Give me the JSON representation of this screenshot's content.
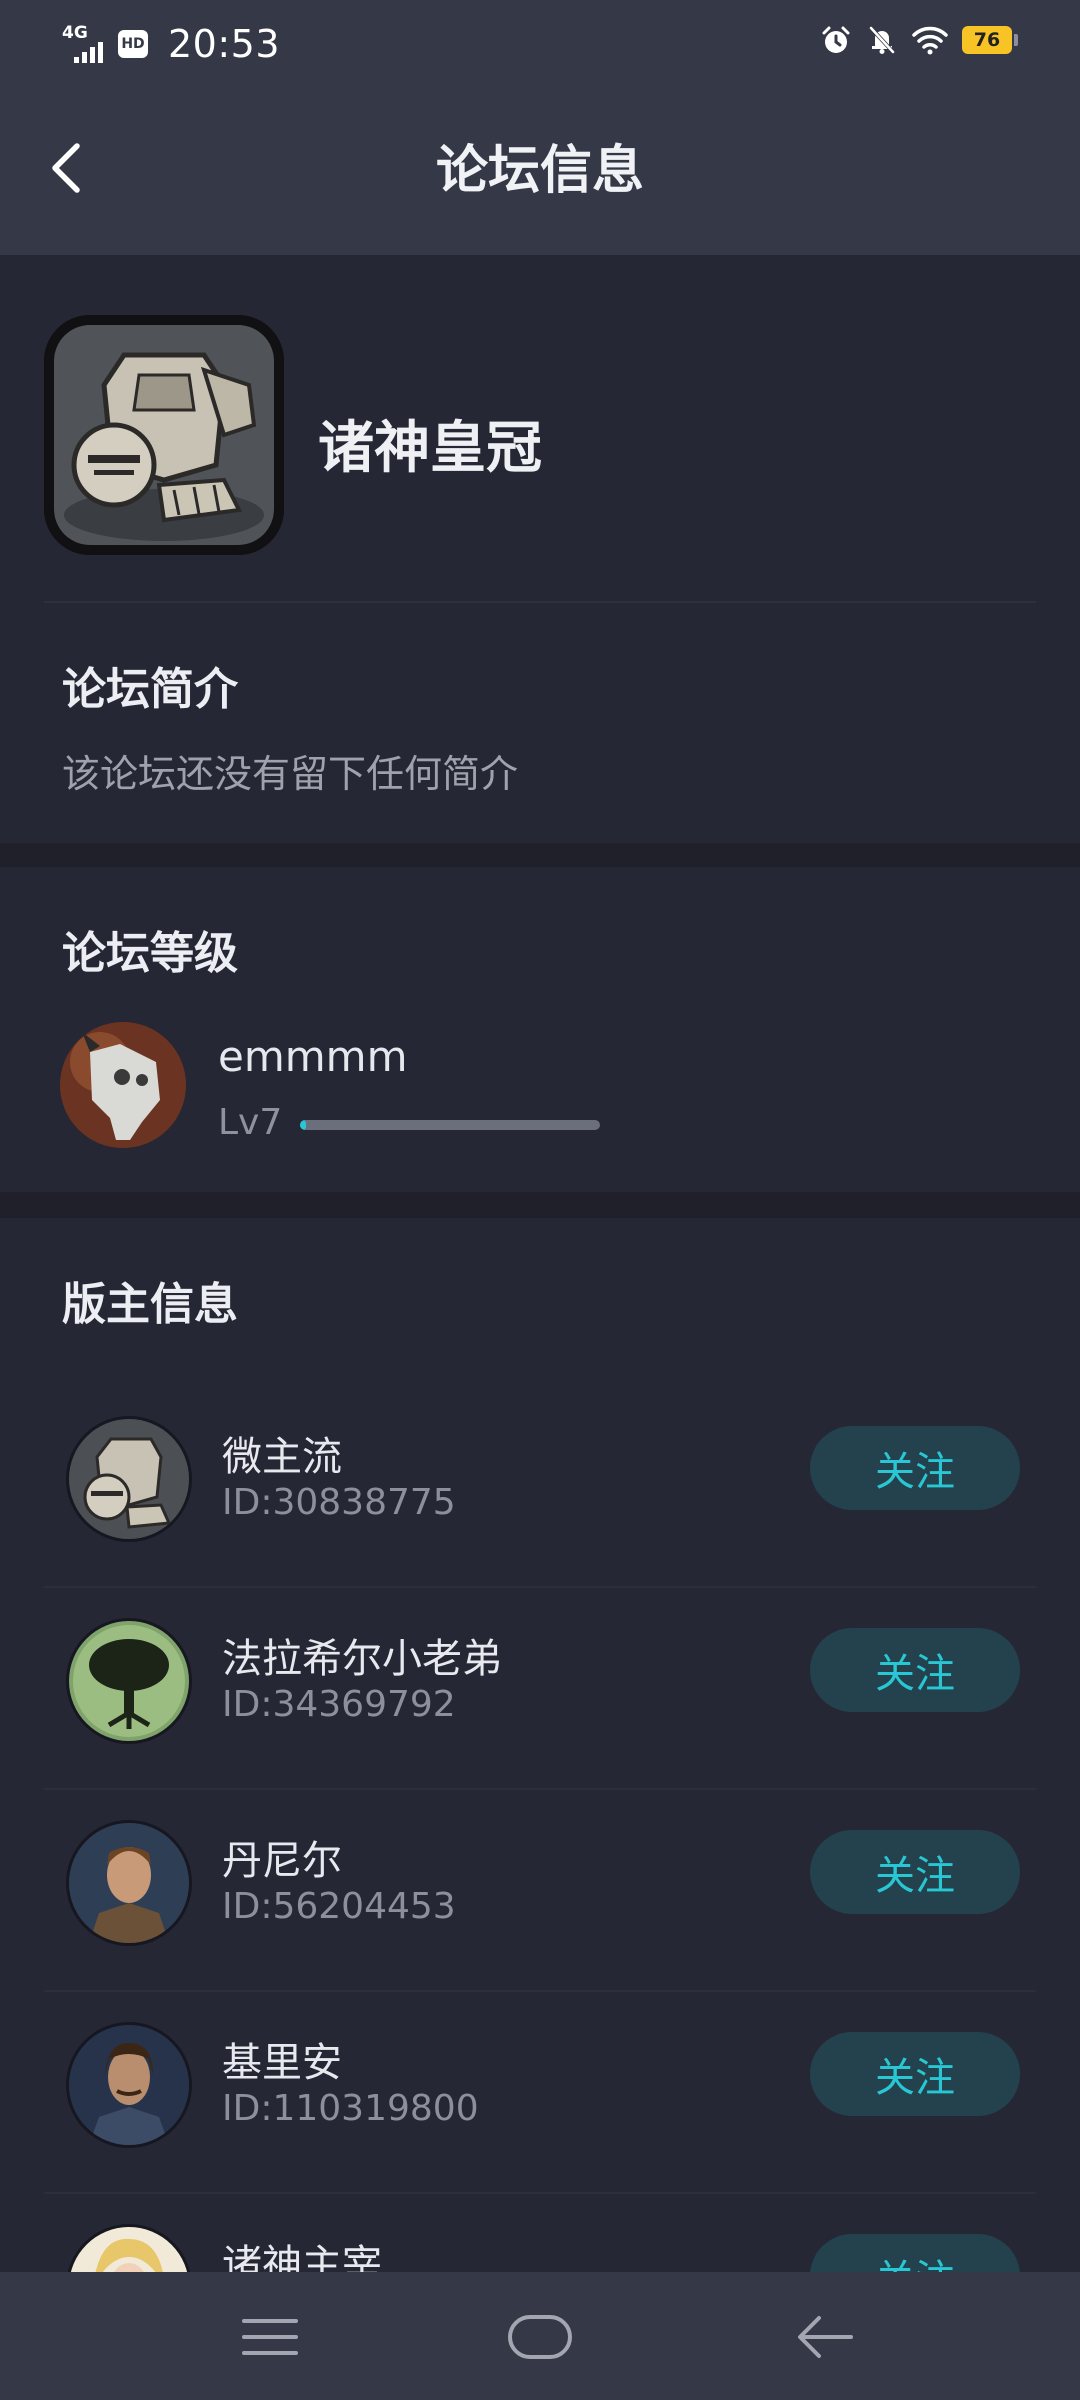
{
  "status_bar": {
    "network": "4G",
    "hd": "HD",
    "time": "20:53",
    "battery": "76",
    "icons": [
      "alarm-icon",
      "mute-bell-icon",
      "wifi-icon",
      "battery-icon"
    ]
  },
  "nav": {
    "title": "论坛信息",
    "back_icon": "chevron-left-icon"
  },
  "forum": {
    "name": "诸神皇冠",
    "icon": "armor-icon"
  },
  "intro": {
    "title": "论坛简介",
    "text": "该论坛还没有留下任何简介"
  },
  "level": {
    "title": "论坛等级",
    "username": "emmmm",
    "level": "Lv7",
    "progress": 0.02
  },
  "moderators": {
    "title": "版主信息",
    "follow_label": "关注",
    "items": [
      {
        "name": "微主流",
        "id": "ID:30838775"
      },
      {
        "name": "法拉希尔小老弟",
        "id": "ID:34369792"
      },
      {
        "name": "丹尼尔",
        "id": "ID:56204453"
      },
      {
        "name": "基里安",
        "id": "ID:110319800"
      },
      {
        "name": "诸神主宰",
        "id": ""
      }
    ]
  },
  "colors": {
    "accent": "#29c7d4",
    "follow_bg": "#23424d",
    "header_bg": "#353846",
    "page_bg": "#262734",
    "battery": "#f7c325"
  },
  "system_nav": [
    "menu-icon",
    "home-icon",
    "back-arrow-icon"
  ]
}
